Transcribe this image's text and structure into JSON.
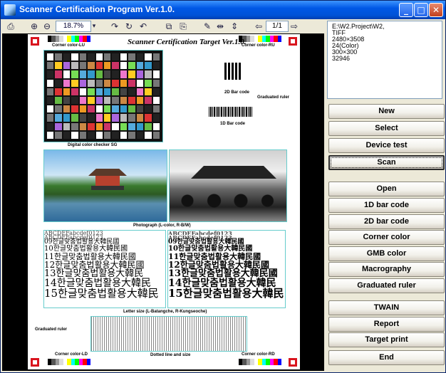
{
  "window": {
    "title": "Scanner Certification Program Ver.1.0."
  },
  "toolbar": {
    "zoom": "18.7%",
    "page": "1/1"
  },
  "target": {
    "title": "Scanner Certification Target Ver.1.0.",
    "corner_lu": "Corner color-LU",
    "corner_ru": "Corner color-RU",
    "corner_ld": "Corner color-LD",
    "corner_rd": "Corner color-RD",
    "checker_label": "Digital color checker SG",
    "bar2d_label": "2D Bar code",
    "graduated_ruler_top": "Graduated ruler",
    "bar1d_label": "1D Bar code",
    "photo_label": "Photograph (L-color, R-B/W)",
    "letter_label": "Letter size (L-Batangche, R-Kungseoche)",
    "graduated_ruler_bottom": "Graduated ruler",
    "dotted_label": "Dotted line and size",
    "letter_lines": [
      "09한글맞춤법활용大韓民國",
      "10한글맞춤법활용大韓民國",
      "11한글맞춤법활용大韓民國",
      "12한글맞춤법활용大韓民國",
      "13한글맞춤법활용大韓民",
      "14한글맞춤법활용大韓民",
      "15한글맞춤법활용大韓民"
    ],
    "letter_lines_right": [
      "09한글맞춤법활용大韓民國",
      "10한글맞춤법활용大韓民國",
      "11한글맞춤법활용大韓民國",
      "12한글맞춤법활용大韓民國",
      "13한글맞춤법활용大韓民國",
      "14한글맞춤법활용大韓民",
      "15한글맞춤법활용大韓民"
    ]
  },
  "info": {
    "lines": [
      "E:\\W2.Project\\W2,",
      "TIFF",
      "2480×3508",
      "24(Color)",
      "300×300",
      "32946"
    ]
  },
  "buttons": {
    "new": "New",
    "select": "Select",
    "device_test": "Device test",
    "scan": "Scan",
    "open": "Open",
    "bar1d": "1D bar code",
    "bar2d": "2D bar code",
    "corner_color": "Corner color",
    "gmb_color": "GMB color",
    "macrography": "Macrography",
    "graduated_ruler": "Graduated ruler",
    "twain": "TWAIN",
    "report": "Report",
    "target_print": "Target print",
    "end": "End"
  }
}
